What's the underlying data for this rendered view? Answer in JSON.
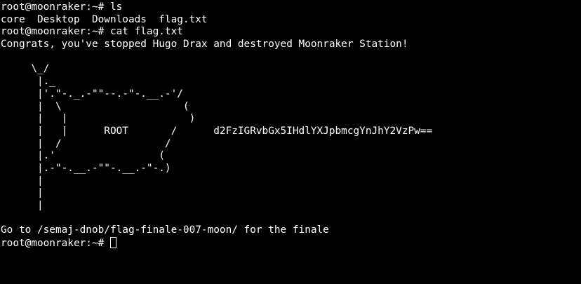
{
  "terminal": {
    "prompt": "root@moonraker:~# ",
    "lines": [
      "root@moonraker:~# ls",
      "core  Desktop  Downloads  flag.txt",
      "root@moonraker:~# cat flag.txt",
      "Congrats, you've stopped Hugo Drax and destroyed Moonraker Station!",
      "",
      "     \\_/",
      "      |._",
      "      |'.\"-._.-\"\"--.-\"-.__.-'/",
      "      |  \\                    (",
      "      |   |                    )",
      "      |   |      ROOT       /      d2FzIGRvbGx5IHdlYXJpbmcgYnJhY2VzPw==",
      "      |  /                 /",
      "      |.'                 (",
      "      |.-\"-.__.-\"\"-.__.-\"-.)",
      "      |",
      "      |",
      "      |",
      "",
      "Go to /semaj-dnob/flag-finale-007-moon/ for the finale"
    ]
  }
}
